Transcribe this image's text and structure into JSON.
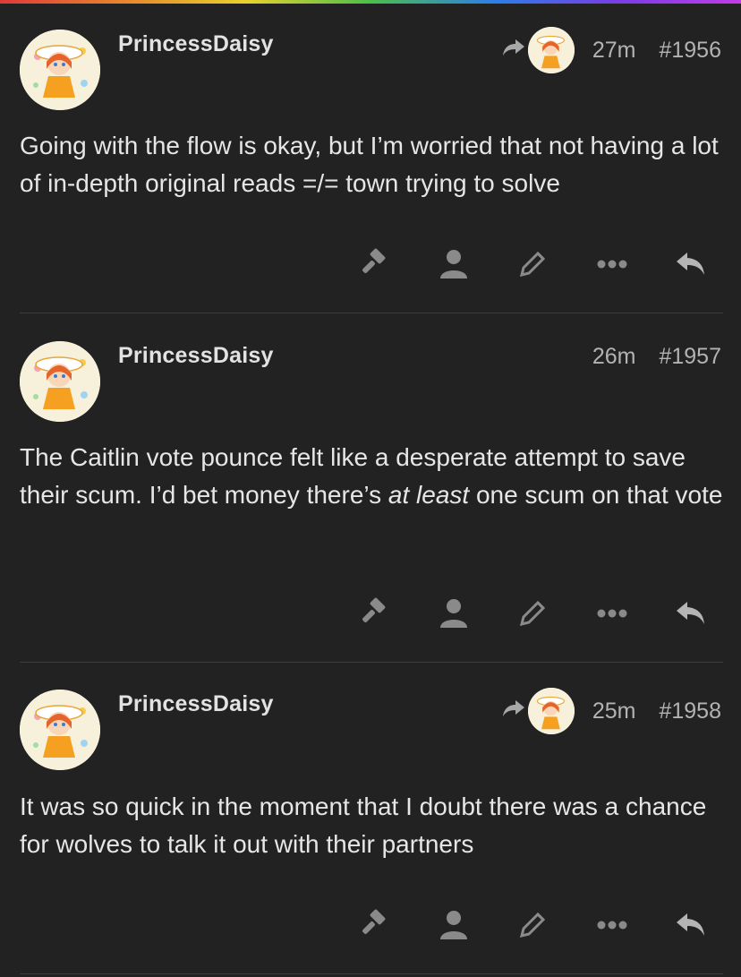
{
  "colors": {
    "background": "#222222",
    "text": "#e6e6e6",
    "muted": "#b3b3b3",
    "icon": "#8a8a8a"
  },
  "posts": [
    {
      "username": "PrincessDaisy",
      "has_reply_to": true,
      "time": "27m",
      "number": "#1956",
      "body": "Going with the flow is okay, but I’m worried that not having a lot of in-depth original reads =/= town trying to solve"
    },
    {
      "username": "PrincessDaisy",
      "has_reply_to": false,
      "time": "26m",
      "number": "#1957",
      "body_before": "The Caitlin vote pounce felt like a desperate attempt to save their scum. I’d bet money there’s ",
      "body_em": "at least",
      "body_after": " one scum on that vote"
    },
    {
      "username": "PrincessDaisy",
      "has_reply_to": true,
      "time": "25m",
      "number": "#1958",
      "body": "It was so quick in the moment that I doubt there was a chance for wolves to talk it out with their partners"
    }
  ],
  "action_icons": [
    "gavel-icon",
    "user-icon",
    "pencil-icon",
    "ellipsis-icon",
    "reply-icon"
  ]
}
